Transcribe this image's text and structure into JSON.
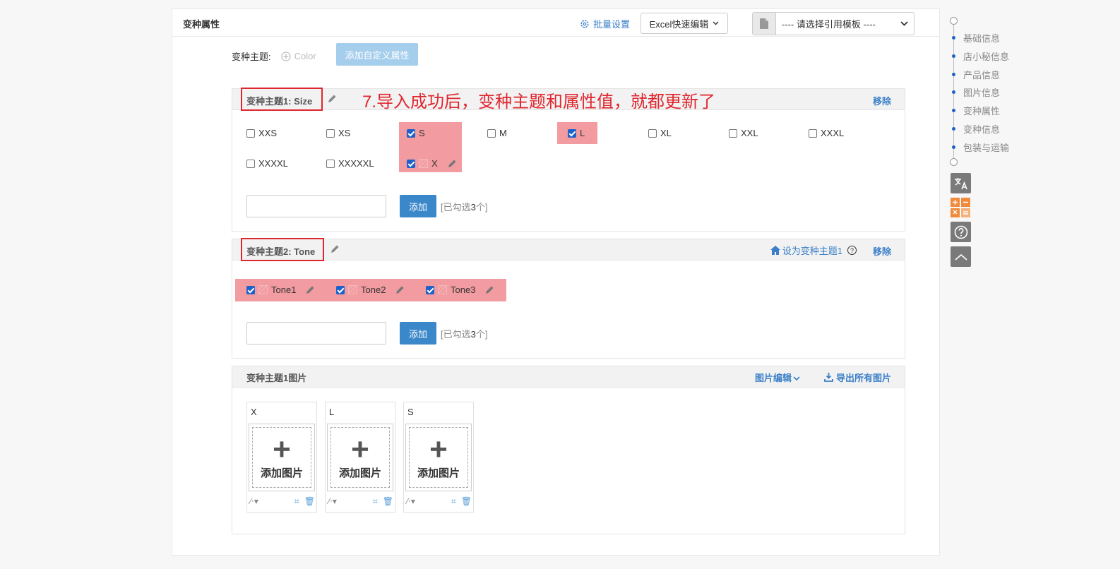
{
  "header": {
    "title": "变种属性",
    "batch_label": "批量设置",
    "excel_label": "Excel快速编辑",
    "template_placeholder": "---- 请选择引用模板 ----"
  },
  "variant_theme": {
    "label": "变种主题:",
    "color_option": "Color",
    "custom_button": "添加自定义属性"
  },
  "annotation": "7.导入成功后，变种主题和属性值，就都更新了",
  "theme1": {
    "title": "变种主题1:  Size",
    "remove_label": "移除",
    "options": [
      {
        "label": "XXS",
        "checked": false
      },
      {
        "label": "XS",
        "checked": false
      },
      {
        "label": "S",
        "checked": true
      },
      {
        "label": "M",
        "checked": false
      },
      {
        "label": "L",
        "checked": true
      },
      {
        "label": "XL",
        "checked": false
      },
      {
        "label": "XXL",
        "checked": false
      },
      {
        "label": "XXXL",
        "checked": false
      },
      {
        "label": "XXXXL",
        "checked": false
      },
      {
        "label": "XXXXXL",
        "checked": false
      },
      {
        "label": "X",
        "checked": true
      }
    ],
    "add_button": "添加",
    "checked_prefix": "[已勾选",
    "checked_count": "3",
    "checked_suffix": "个]"
  },
  "theme2": {
    "title": "变种主题2:  Tone",
    "set_theme1_label": "设为变种主题1",
    "remove_label": "移除",
    "options": [
      {
        "label": "Tone1",
        "checked": true
      },
      {
        "label": "Tone2",
        "checked": true
      },
      {
        "label": "Tone3",
        "checked": true
      }
    ],
    "add_button": "添加",
    "checked_prefix": "[已勾选",
    "checked_count": "3",
    "checked_suffix": "个]"
  },
  "images": {
    "title": "变种主题1图片",
    "edit_label": "图片编辑",
    "export_label": "导出所有图片",
    "add_image_label": "添加图片",
    "cards": [
      {
        "label": "X"
      },
      {
        "label": "L"
      },
      {
        "label": "S"
      }
    ]
  },
  "nav": {
    "items": [
      "基础信息",
      "店小秘信息",
      "产品信息",
      "图片信息",
      "变种属性",
      "变种信息",
      "包装与运输"
    ],
    "accent": "#1e62c9"
  },
  "side_tools": [
    "translate-icon",
    "calculator-icon",
    "help-icon",
    "scroll-top-icon"
  ]
}
